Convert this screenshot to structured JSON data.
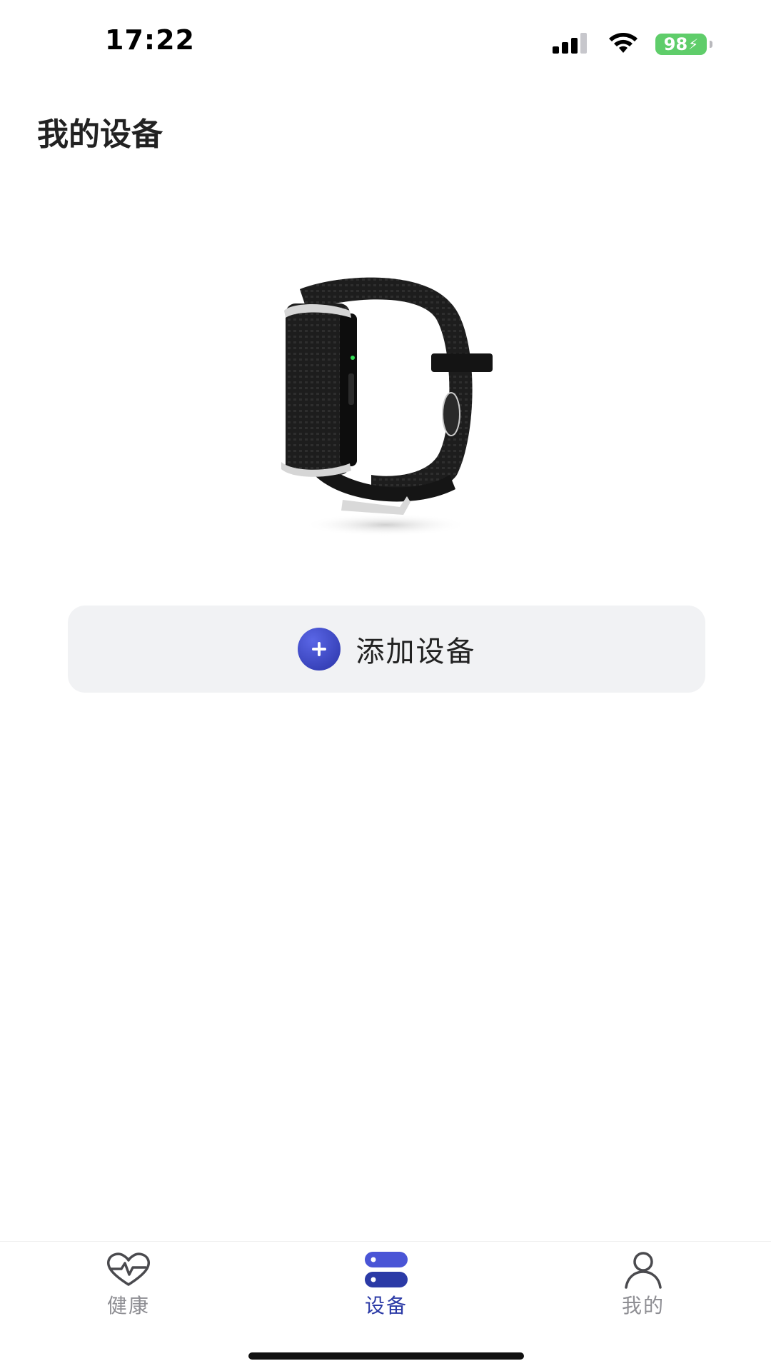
{
  "status_bar": {
    "time": "17:22",
    "battery_level": "98",
    "icons": [
      "cellular-signal-icon",
      "wifi-icon",
      "battery-charging-icon"
    ]
  },
  "header": {
    "title": "我的设备"
  },
  "device": {
    "image_icon": "wristband-device-image"
  },
  "actions": {
    "add_device_label": "添加设备",
    "add_icon": "plus-circle-icon",
    "accent_color": "#2b3aa6"
  },
  "tab_bar": {
    "tabs": [
      {
        "label": "健康",
        "icon": "heart-pulse-icon",
        "active": false
      },
      {
        "label": "设备",
        "icon": "device-stack-icon",
        "active": true
      },
      {
        "label": "我的",
        "icon": "person-icon",
        "active": false
      }
    ],
    "active_color": "#2b3aa6",
    "inactive_color": "#8e8e93"
  }
}
